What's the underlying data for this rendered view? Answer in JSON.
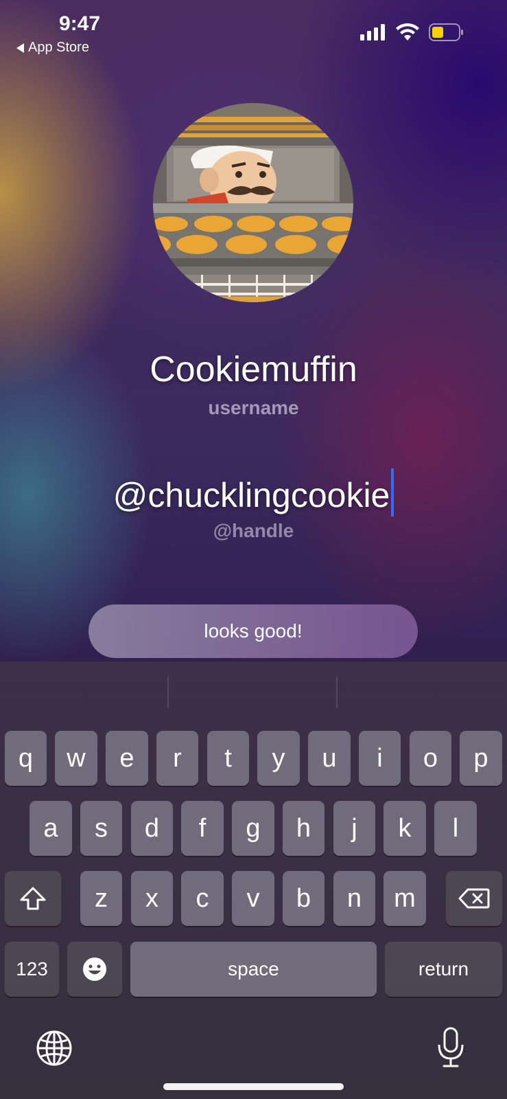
{
  "status_bar": {
    "time": "9:47",
    "back_app": "App Store",
    "battery_color": "#f5d300"
  },
  "profile": {
    "avatar_icon": "baker-chef-avatar",
    "username": "Cookiemuffin",
    "username_label": "username",
    "handle": "@chucklingcookie",
    "handle_label": "@handle",
    "confirm_button": "looks good!"
  },
  "keyboard": {
    "row1": [
      "q",
      "w",
      "e",
      "r",
      "t",
      "y",
      "u",
      "i",
      "o",
      "p"
    ],
    "row2": [
      "a",
      "s",
      "d",
      "f",
      "g",
      "h",
      "j",
      "k",
      "l"
    ],
    "row3": [
      "z",
      "x",
      "c",
      "v",
      "b",
      "n",
      "m"
    ],
    "numbers_key": "123",
    "space_key": "space",
    "return_key": "return"
  },
  "colors": {
    "cursor": "#2f6bff",
    "key_bg": "#767280",
    "text": "#ffffff"
  }
}
